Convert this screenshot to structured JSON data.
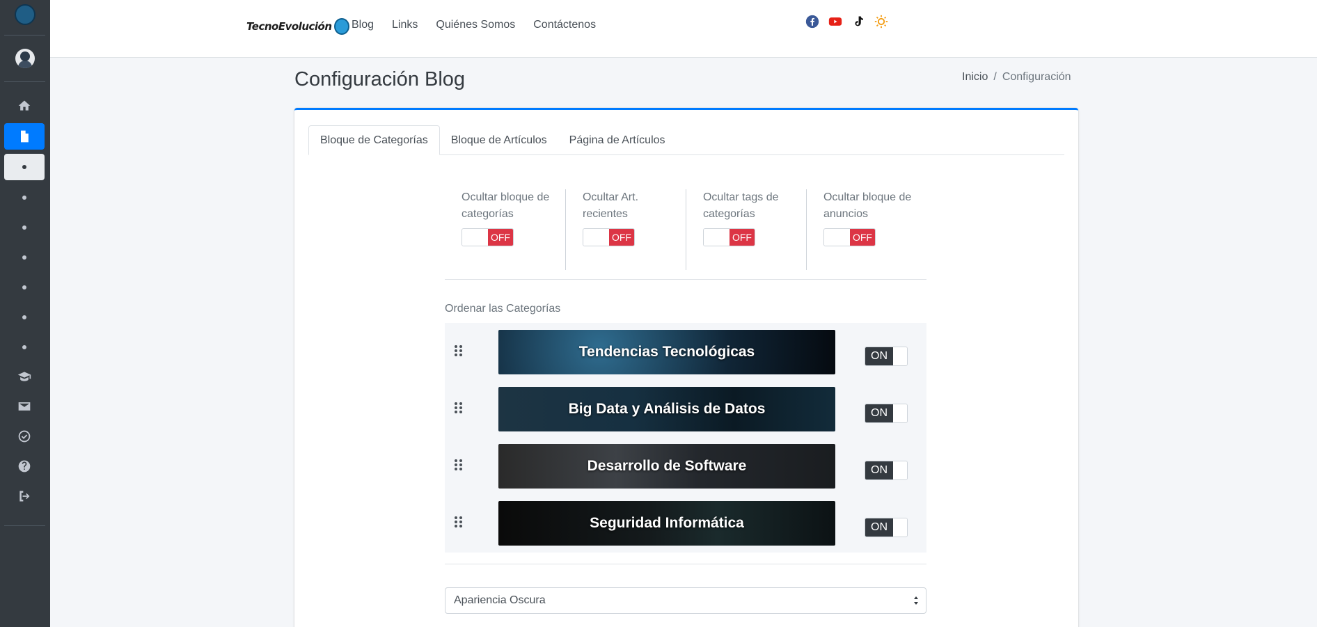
{
  "header": {
    "brand": "TecnoEvolución",
    "nav": [
      "Blog",
      "Links",
      "Quiénes Somos",
      "Contáctenos"
    ],
    "social_icons": [
      "facebook-icon",
      "youtube-icon",
      "tiktok-icon",
      "theme-sun-icon"
    ]
  },
  "sidebar": {
    "icons": [
      "home-icon",
      "document-icon",
      "graduation-cap-icon",
      "envelope-icon",
      "check-circle-icon",
      "question-circle-icon",
      "logout-icon"
    ],
    "sub_items_count": 7
  },
  "page": {
    "title": "Configuración Blog",
    "breadcrumb": {
      "home": "Inicio",
      "sep": "/",
      "current": "Configuración"
    }
  },
  "tabs": [
    "Bloque de Categorías",
    "Bloque de Artículos",
    "Página de Artículos"
  ],
  "toggles": [
    {
      "label": "Ocultar bloque de categorías",
      "state": "OFF"
    },
    {
      "label": "Ocultar Art. recientes",
      "state": "OFF"
    },
    {
      "label": "Ocultar tags de categorías",
      "state": "OFF"
    },
    {
      "label": "Ocultar bloque de anuncios",
      "state": "OFF"
    }
  ],
  "order_label": "Ordenar las Categorías",
  "categories": [
    {
      "name": "Tendencias Tecnológicas",
      "state": "ON"
    },
    {
      "name": "Big Data y Análisis de Datos",
      "state": "ON"
    },
    {
      "name": "Desarrollo de Software",
      "state": "ON"
    },
    {
      "name": "Seguridad Informática",
      "state": "ON"
    }
  ],
  "appearance_select": {
    "value": "Apariencia Oscura"
  },
  "colors": {
    "accent": "#007bff",
    "off": "#dc3545",
    "on": "#343a40",
    "sidebar": "#343a40"
  }
}
